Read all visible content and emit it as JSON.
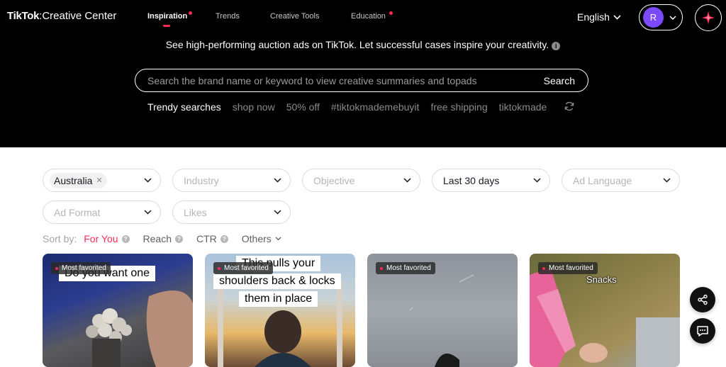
{
  "header": {
    "logo_brand": "TikTok",
    "logo_sub": "Creative Center",
    "nav": [
      {
        "label": "Inspiration",
        "active": true,
        "dot": true
      },
      {
        "label": "Trends",
        "active": false,
        "dot": false
      },
      {
        "label": "Creative Tools",
        "active": false,
        "dot": false
      },
      {
        "label": "Education",
        "active": false,
        "dot": true
      }
    ],
    "language": "English",
    "avatar_initial": "R"
  },
  "hero": {
    "tagline": "See high-performing auction ads on TikTok. Let successful cases inspire your creativity.",
    "search_placeholder": "Search the brand name or keyword to view creative summaries and topads",
    "search_button": "Search",
    "trendy_label": "Trendy searches",
    "trendy_terms": [
      "shop now",
      "50% off",
      "#tiktokmademebuyit",
      "free shipping",
      "tiktokmade"
    ]
  },
  "filters": {
    "region": {
      "placeholder": "",
      "value": "Australia"
    },
    "industry": "Industry",
    "objective": "Objective",
    "period": "Last 30 days",
    "ad_language": "Ad Language",
    "ad_format": "Ad Format",
    "likes": "Likes"
  },
  "sort": {
    "label": "Sort by:",
    "options": [
      {
        "label": "For You",
        "active": true
      },
      {
        "label": "Reach",
        "active": false
      },
      {
        "label": "CTR",
        "active": false
      },
      {
        "label": "Others",
        "active": false
      }
    ]
  },
  "cards": [
    {
      "badge": "Most favorited",
      "caption_lines": [
        "Do you want one"
      ]
    },
    {
      "badge": "Most favorited",
      "caption_lines": [
        "This pulls your",
        "shoulders back & locks",
        "them in place"
      ]
    },
    {
      "badge": "Most favorited",
      "caption_lines": []
    },
    {
      "badge": "Most favorited",
      "caption_lines": [
        "Snacks"
      ]
    }
  ],
  "colors": {
    "accent": "#fe2c55",
    "avatar": "#7b49ff",
    "hero_bg": "#000000"
  }
}
